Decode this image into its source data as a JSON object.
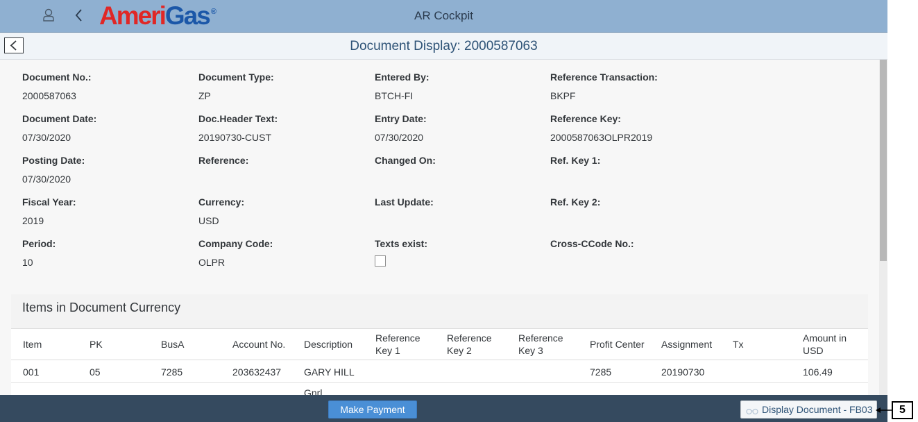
{
  "shell": {
    "logo_part1": "Ameri",
    "logo_part2": "Gas",
    "logo_mark": "®",
    "app_title": "AR Cockpit",
    "icons": {
      "user": "user-icon",
      "back": "back-icon"
    }
  },
  "subheader": {
    "title": "Document Display: 2000587063"
  },
  "fields": {
    "document_no": {
      "label": "Document No.:",
      "value": "2000587063"
    },
    "document_type": {
      "label": "Document Type:",
      "value": "ZP"
    },
    "entered_by": {
      "label": "Entered By:",
      "value": "BTCH-FI"
    },
    "reference_transaction": {
      "label": "Reference Transaction:",
      "value": "BKPF"
    },
    "document_date": {
      "label": "Document Date:",
      "value": "07/30/2020"
    },
    "doc_header_text": {
      "label": "Doc.Header Text:",
      "value": "20190730-CUST"
    },
    "entry_date": {
      "label": "Entry Date:",
      "value": "07/30/2020"
    },
    "reference_key": {
      "label": "Reference Key:",
      "value": "2000587063OLPR2019"
    },
    "posting_date": {
      "label": "Posting Date:",
      "value": "07/30/2020"
    },
    "reference": {
      "label": "Reference:",
      "value": ""
    },
    "changed_on": {
      "label": "Changed On:",
      "value": ""
    },
    "ref_key_1": {
      "label": "Ref. Key 1:",
      "value": ""
    },
    "fiscal_year": {
      "label": "Fiscal Year:",
      "value": "2019"
    },
    "currency": {
      "label": "Currency:",
      "value": "USD"
    },
    "last_update": {
      "label": "Last Update:",
      "value": ""
    },
    "ref_key_2": {
      "label": "Ref. Key 2:",
      "value": ""
    },
    "period": {
      "label": "Period:",
      "value": "10"
    },
    "company_code": {
      "label": "Company Code:",
      "value": "OLPR"
    },
    "texts_exist": {
      "label": "Texts exist:",
      "checked": false
    },
    "cross_ccode_no": {
      "label": "Cross-CCode No.:",
      "value": ""
    }
  },
  "items": {
    "title": "Items in Document Currency",
    "columns": {
      "item": "Item",
      "pk": "PK",
      "busa": "BusA",
      "account_no": "Account No.",
      "description": "Description",
      "reference_key_1": "Reference Key 1",
      "reference_key_2": "Reference Key 2",
      "reference_key_3": "Reference Key 3",
      "profit_center": "Profit Center",
      "assignment": "Assignment",
      "tx": "Tx",
      "amount": "Amount in USD"
    },
    "rows": [
      {
        "item": "001",
        "pk": "05",
        "busa": "7285",
        "account_no": "203632437",
        "description": "GARY HILL",
        "reference_key_1": "",
        "reference_key_2": "",
        "reference_key_3": "",
        "profit_center": "7285",
        "assignment": "20190730",
        "tx": "",
        "amount": "106.49"
      },
      {
        "description": "Gnrl"
      }
    ]
  },
  "footer": {
    "make_payment": "Make Payment",
    "display_document": "Display Document - FB03"
  },
  "callout": {
    "number": "5"
  }
}
